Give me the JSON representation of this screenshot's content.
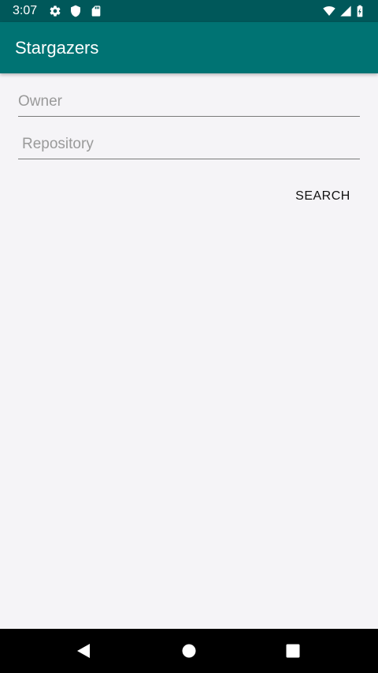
{
  "status_bar": {
    "time": "3:07",
    "icons": [
      "settings-icon",
      "shield-icon",
      "sd-card-icon",
      "wifi-icon",
      "signal-icon",
      "battery-icon"
    ]
  },
  "app_bar": {
    "title": "Stargazers"
  },
  "form": {
    "owner": {
      "placeholder": "Owner",
      "value": ""
    },
    "repository": {
      "placeholder": "Repository",
      "value": ""
    },
    "search_label": "SEARCH"
  },
  "nav": {
    "icons": [
      "back-icon",
      "home-icon",
      "recents-icon"
    ]
  },
  "colors": {
    "status_bar": "#00585a",
    "app_bar": "#007373",
    "background": "#f5f4f7"
  }
}
